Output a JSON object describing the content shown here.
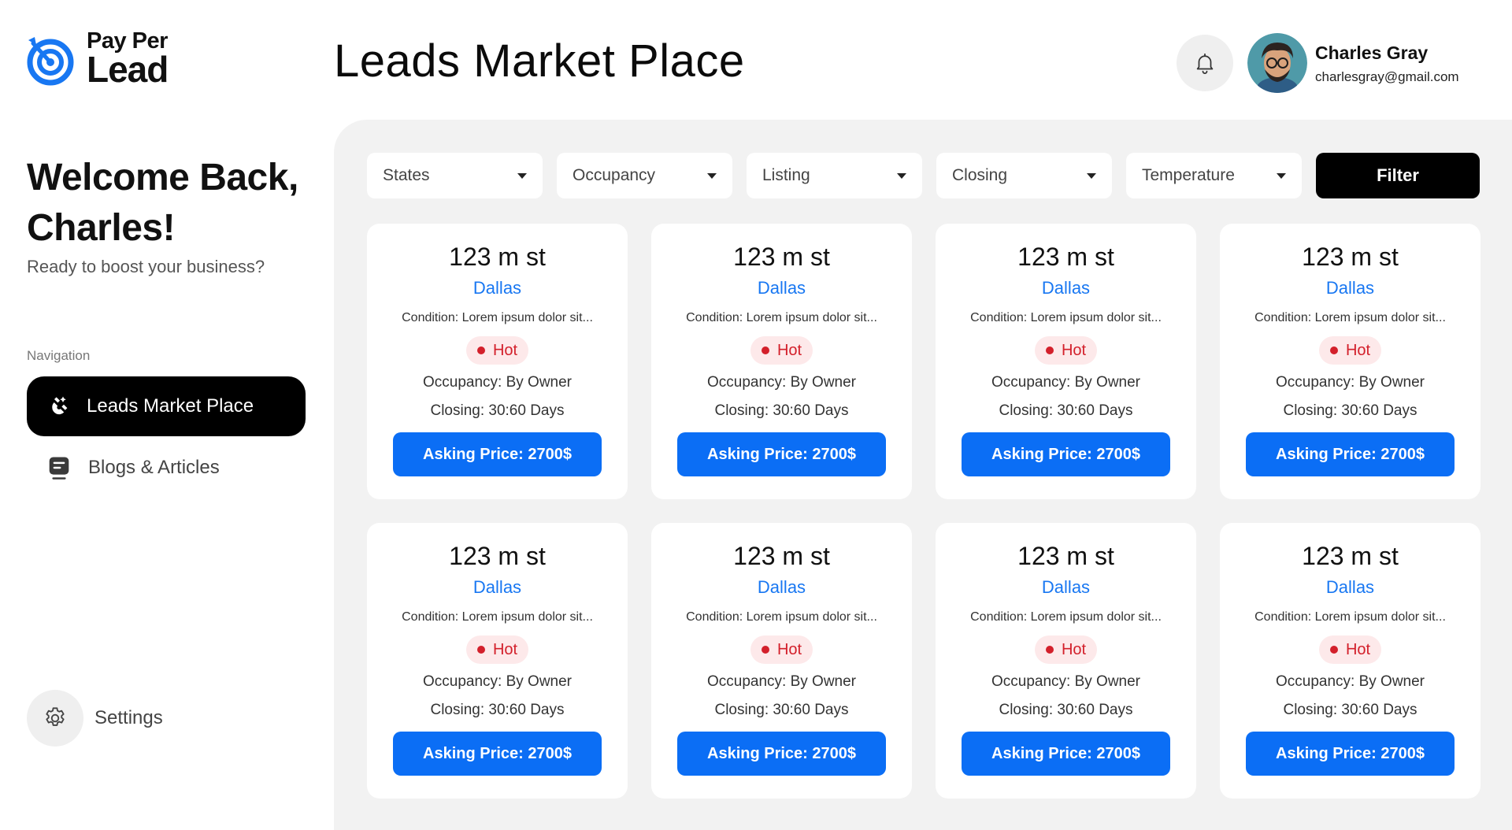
{
  "logo": {
    "top": "Pay Per",
    "bottom": "Lead",
    "icon": "target-icon"
  },
  "header": {
    "title": "Leads Market Place",
    "bell_icon": "bell-icon",
    "user": {
      "name": "Charles Gray",
      "email": "charlesgray@gmail.com"
    }
  },
  "sidebar": {
    "welcome": "Welcome Back, Charles!",
    "subtitle": "Ready to boost your business?",
    "nav_label": "Navigation",
    "items": [
      {
        "label": "Leads Market Place",
        "icon": "magnet-icon",
        "active": true
      },
      {
        "label": "Blogs & Articles",
        "icon": "article-icon",
        "active": false
      }
    ],
    "settings": {
      "label": "Settings",
      "icon": "gear-icon"
    }
  },
  "filters": {
    "selects": [
      "States",
      "Occupancy",
      "Listing",
      "Closing",
      "Temperature"
    ],
    "button": "Filter"
  },
  "colors": {
    "accent": "#0b6ef5",
    "city": "#1877f2",
    "hot": "#d3202b",
    "hot_bg": "#fde9ea",
    "panel": "#f2f2f2"
  },
  "cards": [
    {
      "street": "123 m st",
      "city": "Dallas",
      "condition": "Condition: Lorem ipsum dolor sit...",
      "temperature": "Hot",
      "occupancy": "Occupancy: By Owner",
      "closing": "Closing: 30:60 Days",
      "price": "Asking Price: 2700$"
    },
    {
      "street": "123 m st",
      "city": "Dallas",
      "condition": "Condition: Lorem ipsum dolor sit...",
      "temperature": "Hot",
      "occupancy": "Occupancy: By Owner",
      "closing": "Closing: 30:60 Days",
      "price": "Asking Price: 2700$"
    },
    {
      "street": "123 m st",
      "city": "Dallas",
      "condition": "Condition: Lorem ipsum dolor sit...",
      "temperature": "Hot",
      "occupancy": "Occupancy: By Owner",
      "closing": "Closing: 30:60 Days",
      "price": "Asking Price: 2700$"
    },
    {
      "street": "123 m st",
      "city": "Dallas",
      "condition": "Condition: Lorem ipsum dolor sit...",
      "temperature": "Hot",
      "occupancy": "Occupancy: By Owner",
      "closing": "Closing: 30:60 Days",
      "price": "Asking Price: 2700$"
    },
    {
      "street": "123 m st",
      "city": "Dallas",
      "condition": "Condition: Lorem ipsum dolor sit...",
      "temperature": "Hot",
      "occupancy": "Occupancy: By Owner",
      "closing": "Closing: 30:60 Days",
      "price": "Asking Price: 2700$"
    },
    {
      "street": "123 m st",
      "city": "Dallas",
      "condition": "Condition: Lorem ipsum dolor sit...",
      "temperature": "Hot",
      "occupancy": "Occupancy: By Owner",
      "closing": "Closing: 30:60 Days",
      "price": "Asking Price: 2700$"
    },
    {
      "street": "123 m st",
      "city": "Dallas",
      "condition": "Condition: Lorem ipsum dolor sit...",
      "temperature": "Hot",
      "occupancy": "Occupancy: By Owner",
      "closing": "Closing: 30:60 Days",
      "price": "Asking Price: 2700$"
    },
    {
      "street": "123 m st",
      "city": "Dallas",
      "condition": "Condition: Lorem ipsum dolor sit...",
      "temperature": "Hot",
      "occupancy": "Occupancy: By Owner",
      "closing": "Closing: 30:60 Days",
      "price": "Asking Price: 2700$"
    }
  ]
}
